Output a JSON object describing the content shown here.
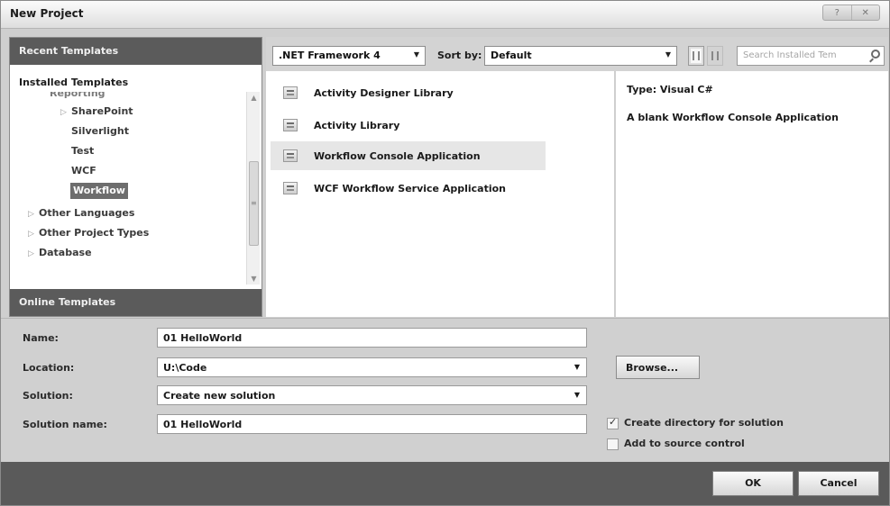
{
  "window": {
    "title": "New Project"
  },
  "left_panel": {
    "recent_header": "Recent Templates",
    "installed_header": "Installed Templates",
    "online_header": "Online Templates",
    "tree_items": [
      {
        "label": "Reporting",
        "selected": false
      },
      {
        "label": "SharePoint",
        "selected": false
      },
      {
        "label": "Silverlight",
        "selected": false
      },
      {
        "label": "Test",
        "selected": false
      },
      {
        "label": "WCF",
        "selected": false
      },
      {
        "label": "Workflow",
        "selected": true
      },
      {
        "label": "Other Languages",
        "selected": false
      },
      {
        "label": "Other Project Types",
        "selected": false
      },
      {
        "label": "Database",
        "selected": false
      }
    ]
  },
  "toolbar": {
    "framework_value": ".NET Framework 4",
    "sort_label": "Sort by:",
    "sort_value": "Default",
    "search_placeholder": "Search Installed Tem"
  },
  "templates": [
    {
      "label": "Activity Designer Library",
      "selected": false
    },
    {
      "label": "Activity Library",
      "selected": false
    },
    {
      "label": "Workflow Console Application",
      "selected": true
    },
    {
      "label": "WCF Workflow Service Application",
      "selected": false
    }
  ],
  "details": {
    "type_text": "Type:  Visual C#",
    "description": "A blank Workflow Console Application"
  },
  "form": {
    "name_label": "Name:",
    "name_value": "01 HelloWorld",
    "location_label": "Location:",
    "location_value": "U:\\Code",
    "solution_label": "Solution:",
    "solution_value": "Create new solution",
    "solution_name_label": "Solution name:",
    "solution_name_value": "01 HelloWorld",
    "browse_label": "Browse...",
    "create_dir_label": "Create directory for solution",
    "create_dir_checked": true,
    "source_control_label": "Add to source control",
    "source_control_checked": false
  },
  "buttons": {
    "ok": "OK",
    "cancel": "Cancel"
  }
}
